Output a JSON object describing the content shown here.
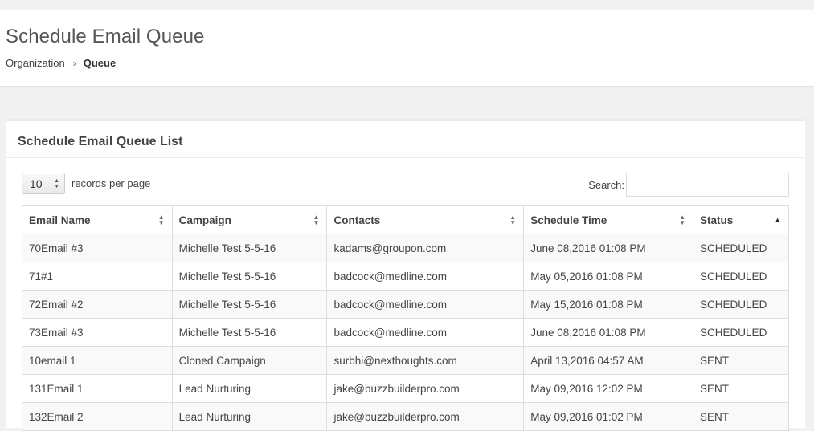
{
  "header": {
    "title": "Schedule Email Queue",
    "breadcrumb": {
      "parent": "Organization",
      "separator": "›",
      "current": "Queue"
    }
  },
  "panel": {
    "title": "Schedule Email Queue List",
    "length": {
      "value": "10",
      "label": "records per page"
    },
    "search": {
      "label": "Search:",
      "value": ""
    }
  },
  "table": {
    "columns": [
      "Email Name",
      "Campaign",
      "Contacts",
      "Schedule Time",
      "Status"
    ],
    "rows": [
      [
        "70Email #3",
        "Michelle Test 5-5-16",
        "kadams@groupon.com",
        "June 08,2016 01:08 PM",
        "SCHEDULED"
      ],
      [
        "71#1",
        "Michelle Test 5-5-16",
        "badcock@medline.com",
        "May 05,2016 01:08 PM",
        "SCHEDULED"
      ],
      [
        "72Email #2",
        "Michelle Test 5-5-16",
        "badcock@medline.com",
        "May 15,2016 01:08 PM",
        "SCHEDULED"
      ],
      [
        "73Email #3",
        "Michelle Test 5-5-16",
        "badcock@medline.com",
        "June 08,2016 01:08 PM",
        "SCHEDULED"
      ],
      [
        "10email 1",
        "Cloned Campaign",
        "surbhi@nexthoughts.com",
        "April 13,2016 04:57 AM",
        "SENT"
      ],
      [
        "131Email 1",
        "Lead Nurturing",
        "jake@buzzbuilderpro.com",
        "May 09,2016 12:02 PM",
        "SENT"
      ],
      [
        "132Email 2",
        "Lead Nurturing",
        "jake@buzzbuilderpro.com",
        "May 09,2016 01:02 PM",
        "SENT"
      ]
    ]
  }
}
